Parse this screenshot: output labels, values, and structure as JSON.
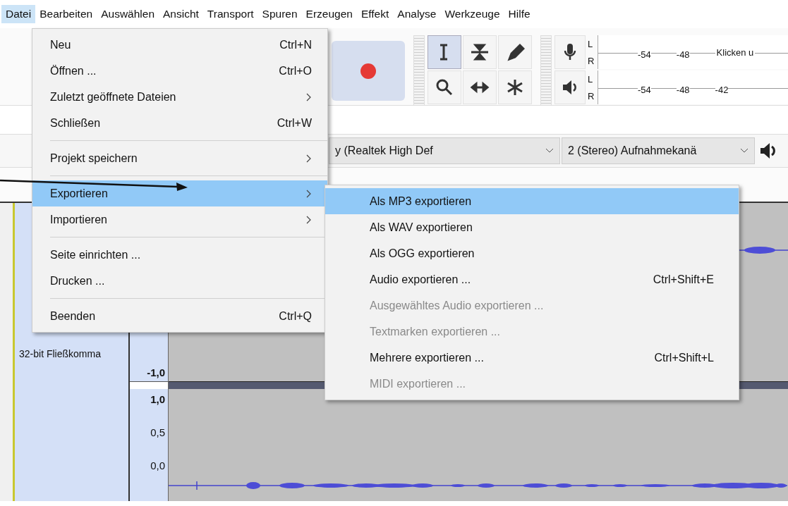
{
  "menubar": [
    {
      "label": "Datei",
      "selected": true
    },
    {
      "label": "Bearbeiten",
      "selected": false
    },
    {
      "label": "Auswählen",
      "selected": false
    },
    {
      "label": "Ansicht",
      "selected": false
    },
    {
      "label": "Transport",
      "selected": false
    },
    {
      "label": "Spuren",
      "selected": false
    },
    {
      "label": "Erzeugen",
      "selected": false
    },
    {
      "label": "Effekt",
      "selected": false
    },
    {
      "label": "Analyse",
      "selected": false
    },
    {
      "label": "Werkzeuge",
      "selected": false
    },
    {
      "label": "Hilfe",
      "selected": false
    }
  ],
  "toolbar": {
    "tools": [
      {
        "kind": "select",
        "selected": true
      },
      {
        "kind": "envelope",
        "selected": false
      },
      {
        "kind": "draw",
        "selected": false
      },
      {
        "kind": "zoom",
        "selected": false
      },
      {
        "kind": "timeshift",
        "selected": false
      },
      {
        "kind": "multi",
        "selected": false
      }
    ],
    "meters": [
      {
        "kind": "record",
        "channels": [
          "L",
          "R"
        ],
        "ticks": [
          "-54",
          "-48"
        ],
        "hint": "Klicken u"
      },
      {
        "kind": "playback",
        "channels": [
          "L",
          "R"
        ],
        "ticks": [
          "-54",
          "-48",
          "-42"
        ]
      }
    ]
  },
  "device_bar": {
    "device": "y (Realtek High Def",
    "channels": "2 (Stereo) Aufnahmekanä"
  },
  "track": {
    "info": "32-bit Fließkomma",
    "upper_scale": [
      "-1,0"
    ],
    "lower_scale": [
      "1,0",
      "0,5",
      "0,0"
    ]
  },
  "file_menu": {
    "items": [
      {
        "kind": "item",
        "label": "Neu",
        "shortcut": "Ctrl+N",
        "submenu": false,
        "selected": false
      },
      {
        "kind": "item",
        "label": "Öffnen ...",
        "shortcut": "Ctrl+O",
        "submenu": false,
        "selected": false
      },
      {
        "kind": "item",
        "label": "Zuletzt geöffnete Dateien",
        "submenu": true,
        "selected": false
      },
      {
        "kind": "item",
        "label": "Schließen",
        "shortcut": "Ctrl+W",
        "submenu": false,
        "selected": false
      },
      {
        "kind": "separator"
      },
      {
        "kind": "item",
        "label": "Projekt speichern",
        "submenu": true,
        "selected": false
      },
      {
        "kind": "separator"
      },
      {
        "kind": "item",
        "label": "Exportieren",
        "submenu": true,
        "selected": true
      },
      {
        "kind": "item",
        "label": "Importieren",
        "submenu": true,
        "selected": false
      },
      {
        "kind": "separator"
      },
      {
        "kind": "item",
        "label": "Seite einrichten ...",
        "submenu": false,
        "selected": false
      },
      {
        "kind": "item",
        "label": "Drucken ...",
        "submenu": false,
        "selected": false
      },
      {
        "kind": "separator"
      },
      {
        "kind": "item",
        "label": "Beenden",
        "shortcut": "Ctrl+Q",
        "submenu": false,
        "selected": false
      }
    ]
  },
  "export_menu": {
    "items": [
      {
        "label": "Als MP3 exportieren",
        "selected": true,
        "disabled": false
      },
      {
        "label": "Als WAV exportieren",
        "selected": false,
        "disabled": false
      },
      {
        "label": "Als OGG exportieren",
        "selected": false,
        "disabled": false
      },
      {
        "label": "Audio exportieren ...",
        "shortcut": "Ctrl+Shift+E",
        "selected": false,
        "disabled": false
      },
      {
        "label": "Ausgewähltes Audio exportieren ...",
        "selected": false,
        "disabled": true
      },
      {
        "label": "Textmarken exportieren ...",
        "selected": false,
        "disabled": true
      },
      {
        "label": "Mehrere exportieren ...",
        "shortcut": "Ctrl+Shift+L",
        "selected": false,
        "disabled": false
      },
      {
        "label": "MIDI exportieren ...",
        "selected": false,
        "disabled": true
      }
    ]
  }
}
